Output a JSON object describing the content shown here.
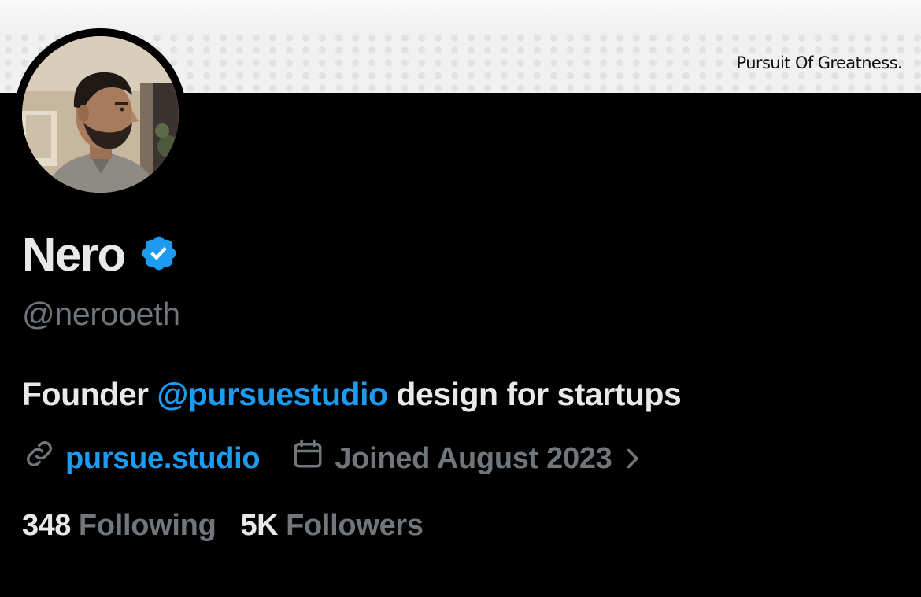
{
  "banner": {
    "tagline": "Pursuit Of Greatness."
  },
  "avatar": {
    "alt": "Nero profile photo"
  },
  "profile": {
    "name": "Nero",
    "verified_icon": "verified-badge-icon",
    "handle": "@nerooeth",
    "bio": {
      "prefix": "Founder ",
      "mention": "@pursuestudio",
      "suffix": " design for startups"
    },
    "website": {
      "icon": "link-icon",
      "label": "pursue.studio"
    },
    "joined": {
      "icon": "calendar-icon",
      "label": "Joined August 2023",
      "chevron_icon": "chevron-right-icon"
    },
    "following": {
      "count": "348",
      "label": "Following"
    },
    "followers": {
      "count": "5K",
      "label": "Followers"
    }
  },
  "colors": {
    "background": "#000000",
    "primary_text": "#e7e9ea",
    "secondary_text": "#71767b",
    "accent": "#1d9bf0",
    "banner": "#f1f1f1"
  }
}
